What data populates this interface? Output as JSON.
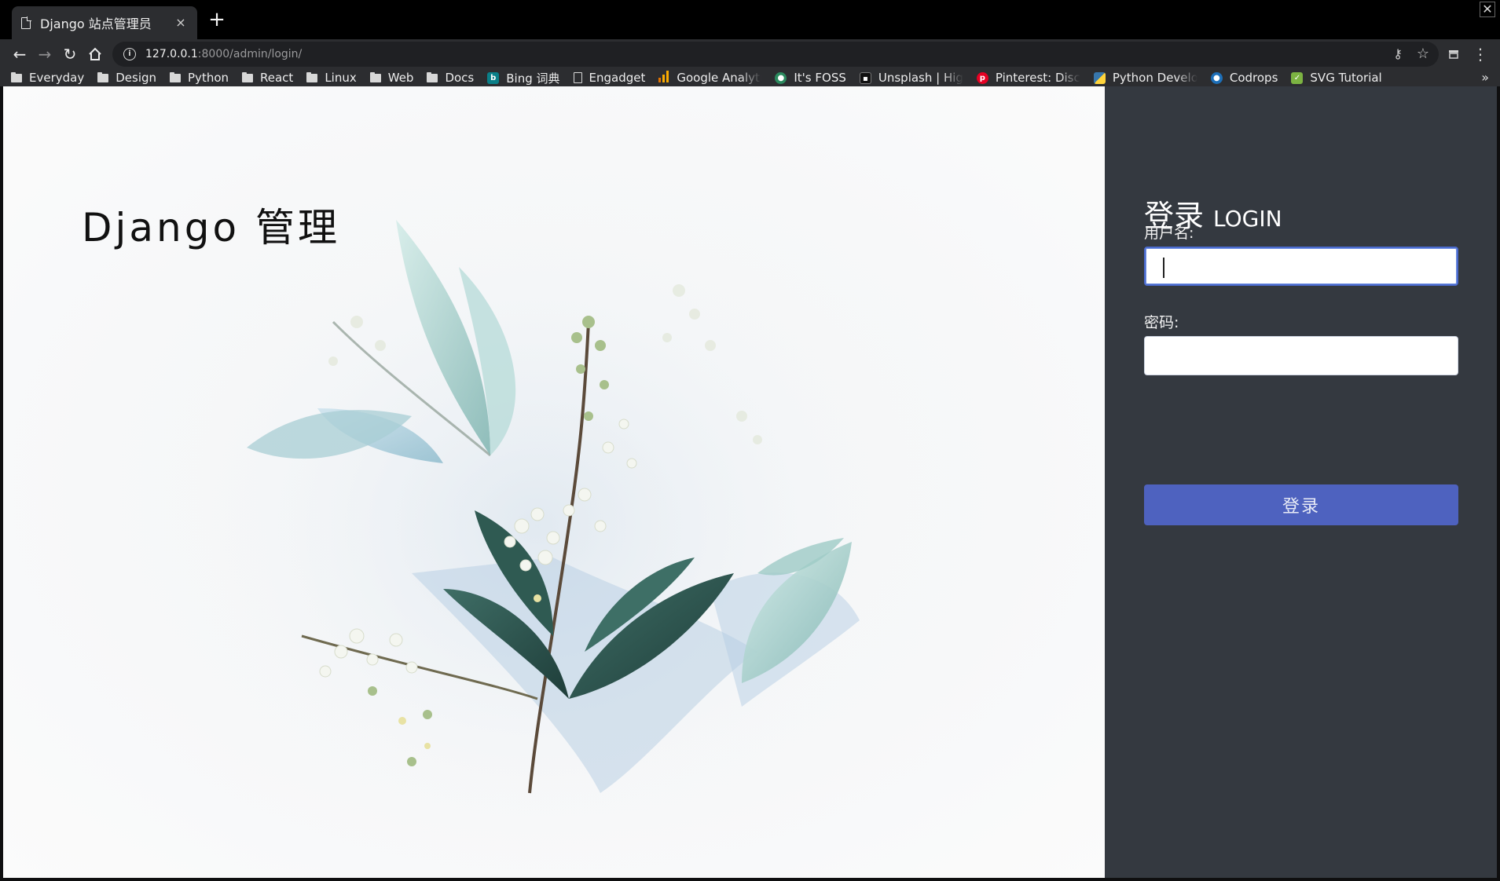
{
  "browser": {
    "tab_title": "Django 站点管理员",
    "tab_close": "×",
    "new_tab": "+",
    "window_close": "✕",
    "url_host": "127.0.0.1",
    "url_path": ":8000/admin/login/",
    "bookmarks": [
      {
        "label": "Everyday",
        "icon": "folder-icon"
      },
      {
        "label": "Design",
        "icon": "folder-icon"
      },
      {
        "label": "Python",
        "icon": "folder-icon"
      },
      {
        "label": "React",
        "icon": "folder-icon"
      },
      {
        "label": "Linux",
        "icon": "folder-icon"
      },
      {
        "label": "Web",
        "icon": "folder-icon"
      },
      {
        "label": "Docs",
        "icon": "folder-icon"
      },
      {
        "label": "Bing 词典",
        "icon": "bing-icon"
      },
      {
        "label": "Engadget",
        "icon": "page-icon"
      },
      {
        "label": "Google Analytics",
        "icon": "analytics-icon"
      },
      {
        "label": "It's FOSS",
        "icon": "itsfoss-icon"
      },
      {
        "label": "Unsplash | High",
        "icon": "unsplash-icon"
      },
      {
        "label": "Pinterest: Discov",
        "icon": "pinterest-icon"
      },
      {
        "label": "Python Develope",
        "icon": "python-icon"
      },
      {
        "label": "Codrops",
        "icon": "codrops-icon"
      },
      {
        "label": "SVG Tutorial",
        "icon": "svg-icon"
      }
    ],
    "bookmarks_overflow": "»"
  },
  "hero": {
    "site_title": "Django 管理"
  },
  "login": {
    "title_cn": "登录",
    "title_en": "LOGIN",
    "username_label": "用户名:",
    "username_value": "",
    "password_label": "密码:",
    "password_value": "",
    "submit_label": "登录"
  },
  "colors": {
    "panel_bg": "#343940",
    "button_bg": "#4e62bf",
    "focus_border": "#4b6bcf"
  }
}
